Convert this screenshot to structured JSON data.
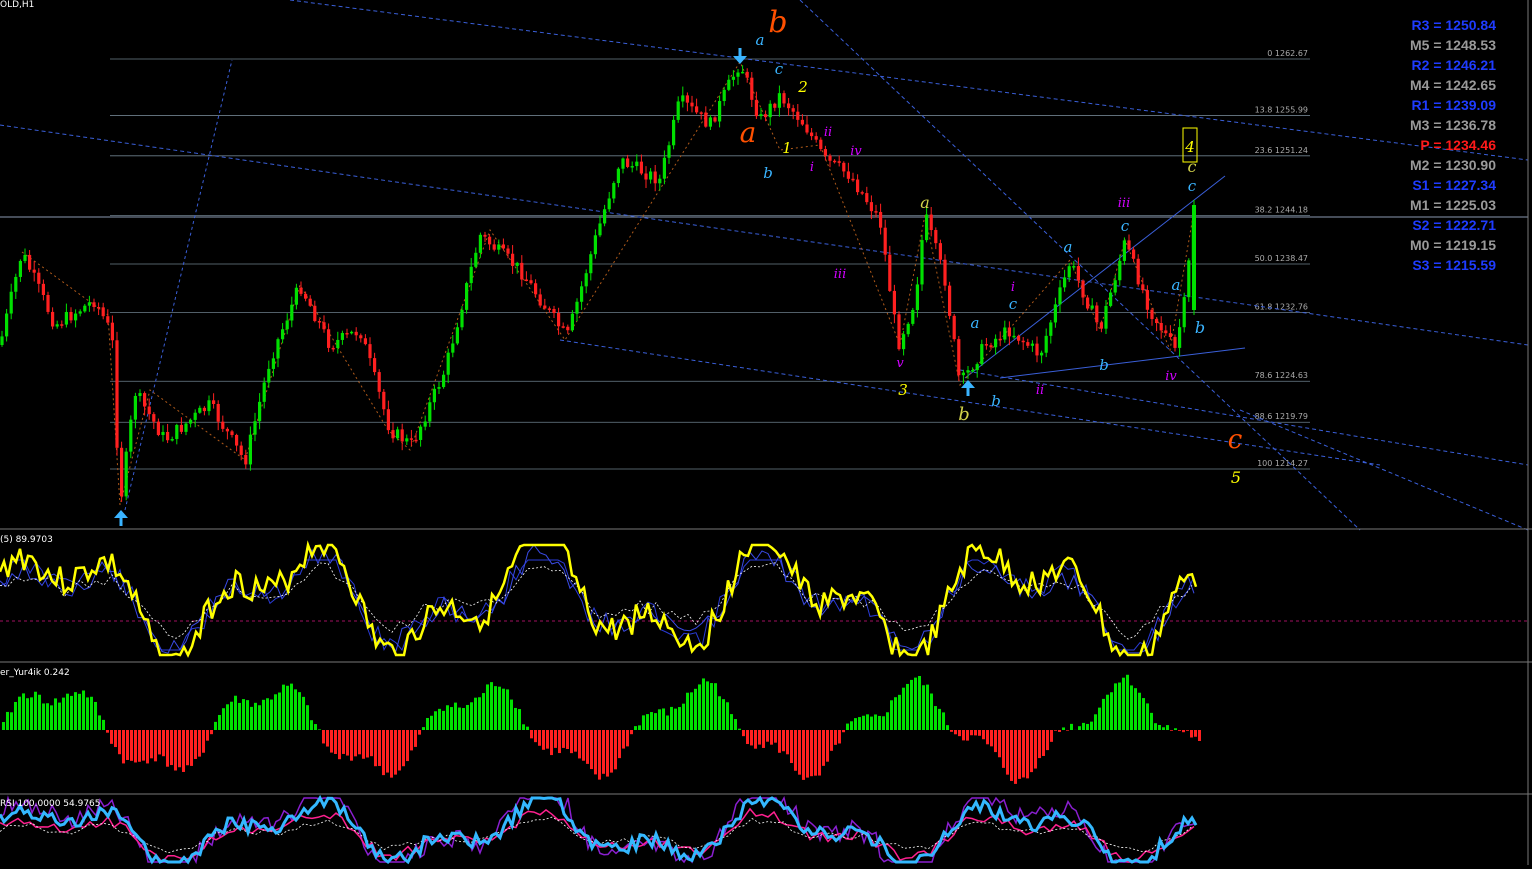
{
  "window": {
    "title": "OLD,H1"
  },
  "colors": {
    "bull": "#00e000",
    "bear": "#ff2020",
    "trend": "#3a5fd9",
    "fib": "#6e7f8c",
    "yellow": "#ffff00",
    "cyan": "#3ab4ff",
    "magenta": "#d000ff",
    "orange": "#ff5000",
    "khaki": "#d2d24a",
    "red": "#ff0000"
  },
  "fib_levels": [
    {
      "label": "0 1262.67",
      "value": 1262.67
    },
    {
      "label": "13.8 1255.99",
      "value": 1255.99
    },
    {
      "label": "23.6 1251.24",
      "value": 1251.24
    },
    {
      "label": "38.2 1244.18",
      "value": 1244.18
    },
    {
      "label": "50.0 1238.47",
      "value": 1238.47
    },
    {
      "label": "61.8 1232.76",
      "value": 1232.76
    },
    {
      "label": "78.6 1224.63",
      "value": 1224.63
    },
    {
      "label": "88.6 1219.79",
      "value": 1219.79
    },
    {
      "label": "100 1214.27",
      "value": 1214.27
    }
  ],
  "pivots": [
    {
      "label": "R3 = 1250.84",
      "color": "#1f3cff"
    },
    {
      "label": "M5 = 1248.53",
      "color": "#9a9a9a"
    },
    {
      "label": "R2 = 1246.21",
      "color": "#1f3cff"
    },
    {
      "label": "M4 = 1242.65",
      "color": "#9a9a9a"
    },
    {
      "label": "R1 = 1239.09",
      "color": "#1f3cff"
    },
    {
      "label": "M3 = 1236.78",
      "color": "#9a9a9a"
    },
    {
      "label": "P = 1234.46",
      "color": "#ff1a1a"
    },
    {
      "label": "M2 = 1230.90",
      "color": "#9a9a9a"
    },
    {
      "label": "S1 = 1227.34",
      "color": "#1f3cff"
    },
    {
      "label": "M1 = 1225.03",
      "color": "#9a9a9a"
    },
    {
      "label": "S2 = 1222.71",
      "color": "#1f3cff"
    },
    {
      "label": "M0 = 1219.15",
      "color": "#9a9a9a"
    },
    {
      "label": "S3 = 1215.59",
      "color": "#1f3cff"
    }
  ],
  "indicators": {
    "stoch_label": "(5) 89.9703",
    "histogram_label": "er_Yur4ik 0.242",
    "rsi_label": "RSI 100.0000 54.9765"
  },
  "wave_labels": [
    {
      "text": "b",
      "color": "#ff5000",
      "size": 30
    },
    {
      "text": "a",
      "color": "#ff5000",
      "size": 28
    },
    {
      "text": "c",
      "color": "#ff5000",
      "size": 26
    },
    {
      "text": "a",
      "color": "#3ab4ff",
      "size": 15
    },
    {
      "text": "c",
      "color": "#3ab4ff",
      "size": 15
    },
    {
      "text": "b",
      "color": "#3ab4ff",
      "size": 15
    },
    {
      "text": "2",
      "color": "#ffff00",
      "size": 15
    },
    {
      "text": "1",
      "color": "#ffff00",
      "size": 15
    },
    {
      "text": "ii",
      "color": "#d000ff",
      "size": 13
    },
    {
      "text": "i",
      "color": "#d000ff",
      "size": 13
    },
    {
      "text": "iv",
      "color": "#d000ff",
      "size": 13
    },
    {
      "text": "iii",
      "color": "#d000ff",
      "size": 13
    },
    {
      "text": "a",
      "color": "#d2d24a",
      "size": 16
    },
    {
      "text": "v",
      "color": "#d000ff",
      "size": 13
    },
    {
      "text": "3",
      "color": "#ffff00",
      "size": 15
    },
    {
      "text": "b",
      "color": "#d2d24a",
      "size": 18
    },
    {
      "text": "a",
      "color": "#3ab4ff",
      "size": 15
    },
    {
      "text": "b",
      "color": "#3ab4ff",
      "size": 15
    },
    {
      "text": "i",
      "color": "#d000ff",
      "size": 13
    },
    {
      "text": "c",
      "color": "#3ab4ff",
      "size": 15
    },
    {
      "text": "ii",
      "color": "#d000ff",
      "size": 13
    },
    {
      "text": "a",
      "color": "#3ab4ff",
      "size": 15
    },
    {
      "text": "b",
      "color": "#3ab4ff",
      "size": 15
    },
    {
      "text": "iii",
      "color": "#d000ff",
      "size": 13
    },
    {
      "text": "c",
      "color": "#3ab4ff",
      "size": 15
    },
    {
      "text": "a",
      "color": "#3ab4ff",
      "size": 15
    },
    {
      "text": "iv",
      "color": "#d000ff",
      "size": 13
    },
    {
      "text": "4",
      "color": "#ffff00",
      "size": 15
    },
    {
      "text": "c",
      "color": "#d2d24a",
      "size": 16
    },
    {
      "text": "c",
      "color": "#3ab4ff",
      "size": 15
    },
    {
      "text": "b",
      "color": "#3ab4ff",
      "size": 16
    },
    {
      "text": "5",
      "color": "#ffff00",
      "size": 16
    }
  ]
}
